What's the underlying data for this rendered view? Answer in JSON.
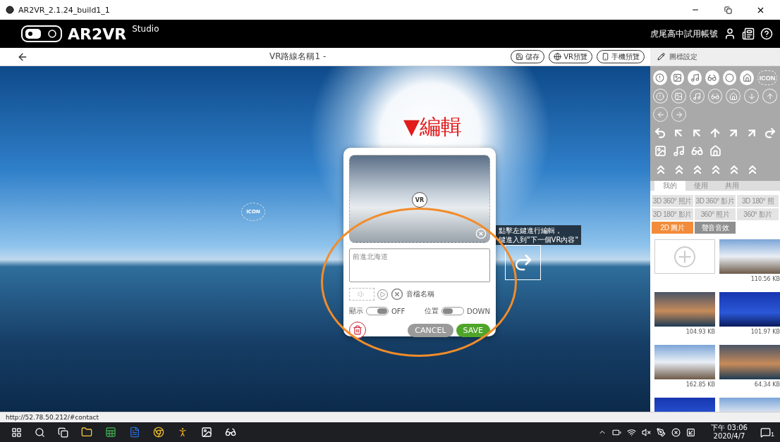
{
  "window": {
    "title": "AR2VR_2.1.24_build1_1"
  },
  "header": {
    "brand": "AR2VR",
    "brand_suffix": "Studio",
    "account": "虎尾高中試用帳號"
  },
  "toolbar": {
    "route_name": "VR路線名稱1 -",
    "buttons": [
      {
        "label": "儲存",
        "kind": "save"
      },
      {
        "label": "VR預覽",
        "kind": "vr"
      },
      {
        "label": "手機預覽",
        "kind": "phone"
      }
    ]
  },
  "scene": {
    "annotation": "▼編輯",
    "marker_label": "ICON",
    "tooltip": [
      "點擊左鍵進行編輯，",
      "鍵進入到\"下一個VR內容\""
    ]
  },
  "editor": {
    "photo_badge": "VR",
    "description": "前進北海道",
    "audio_name": "音檔名稱",
    "toggles": [
      {
        "label": "顯示",
        "state": "OFF",
        "on": true
      },
      {
        "label": "位置",
        "state": "DOWN",
        "on": false
      }
    ],
    "buttons": [
      {
        "label": "CANCEL",
        "kind": "cancel"
      },
      {
        "label": "SAVE",
        "kind": "save"
      }
    ]
  },
  "panel": {
    "title": "圖標設定",
    "icon_label": "ICON",
    "tabs": [
      {
        "label": "我的",
        "selected": true
      },
      {
        "label": "使用",
        "selected": false
      },
      {
        "label": "共用",
        "selected": false
      }
    ],
    "categories": [
      {
        "label": "3D 360° 照片",
        "selected": false,
        "disabled": true
      },
      {
        "label": "3D 360° 影片",
        "selected": false,
        "disabled": true
      },
      {
        "label": "3D 180° 照",
        "selected": false,
        "disabled": true
      },
      {
        "label": "3D 180° 影片",
        "selected": false,
        "disabled": true
      },
      {
        "label": "360° 照片",
        "selected": false,
        "disabled": true
      },
      {
        "label": "360° 影片",
        "selected": false,
        "disabled": true
      },
      {
        "label": "2D 圖片",
        "selected": true,
        "disabled": false
      },
      {
        "label": "聲音音效",
        "selected": false,
        "disabled": false
      }
    ],
    "media": [
      {
        "kind": "add"
      },
      {
        "kind": "photo",
        "size": "110.56 KB"
      },
      {
        "kind": "photo",
        "size": "104.93 KB"
      },
      {
        "kind": "photo",
        "size": "101.97 KB"
      },
      {
        "kind": "photo",
        "size": "162.85 KB"
      },
      {
        "kind": "photo",
        "size": "64.34 KB"
      },
      {
        "kind": "photo"
      },
      {
        "kind": "photo"
      }
    ]
  },
  "status_bar": {
    "url": "http://52.78.50.212/#contact"
  },
  "taskbar": {
    "time": "下午 03:06",
    "date": "2020/4/7",
    "notifications": "1"
  }
}
